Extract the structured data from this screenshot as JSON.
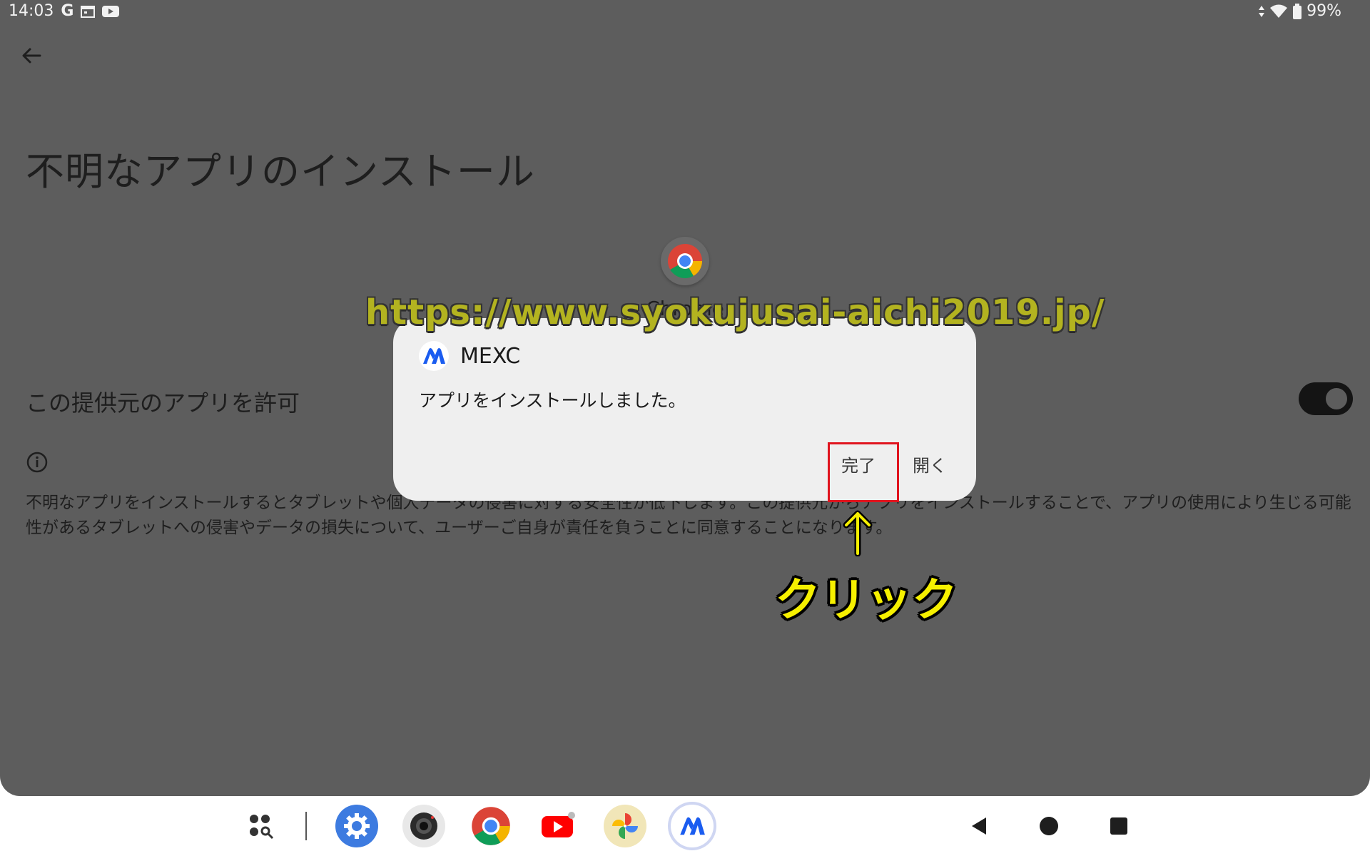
{
  "status_bar": {
    "time": "14:03",
    "left_icons": [
      "google-g-icon",
      "calendar-icon",
      "youtube-notification-icon"
    ],
    "google_letter": "G",
    "battery": "99%",
    "right_icons": [
      "data-arrows-icon",
      "wifi-icon",
      "battery-icon"
    ]
  },
  "settings_page": {
    "title": "不明なアプリのインストール",
    "source_app_name": "Chrome",
    "allow_label": "この提供元のアプリを許可",
    "allow_enabled": true,
    "warning_text": "不明なアプリをインストールするとタブレットや個人データの侵害に対する安全性が低下します。この提供元からアプリをインストールすることで、アプリの使用により生じる可能性があるタブレットへの侵害やデータの損失について、ユーザーご自身が責任を負うことに同意することになります。"
  },
  "dialog": {
    "app_name": "MEXC",
    "message": "アプリをインストールしました。",
    "done_label": "完了",
    "open_label": "開く"
  },
  "annotation": {
    "watermark": "https://www.syokujusai-aichi2019.jp/",
    "click_label": "クリック"
  },
  "taskbar": {
    "apps": [
      "app-drawer-icon",
      "settings-icon",
      "camera-icon",
      "chrome-icon",
      "youtube-icon",
      "photos-icon",
      "mexc-icon"
    ],
    "nav": [
      "back-icon",
      "home-icon",
      "recents-icon"
    ]
  },
  "colors": {
    "dim_background": "#5d5d5d",
    "dialog_background": "#efefef",
    "highlight_red": "#e0141e",
    "annotation_yellow": "#f6f000",
    "mexc_blue": "#1a5cf0"
  }
}
